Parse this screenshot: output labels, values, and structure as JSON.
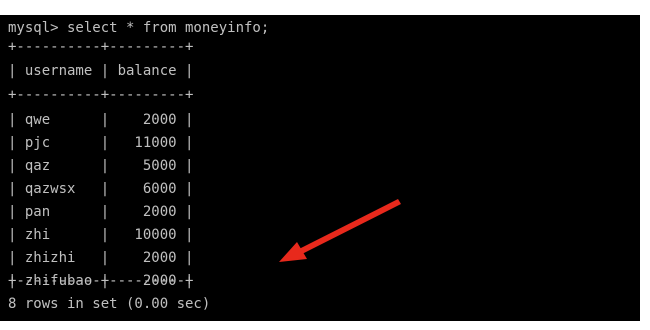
{
  "terminal": {
    "prompt_line": "mysql> select * from moneyinfo;",
    "border_line": "+----------+---------+",
    "header_line": "| username | balance |",
    "rows": [
      "| qwe      |    2000 |",
      "| pjc      |   11000 |",
      "| qaz      |    5000 |",
      "| qazwsx   |    6000 |",
      "| pan      |    2000 |",
      "| zhi      |   10000 |",
      "| zhizhi   |    2000 |",
      "| zhifubao |    2000 |"
    ],
    "footer_line": "8 rows in set (0.00 sec)"
  },
  "table": {
    "columns": [
      "username",
      "balance"
    ],
    "data": [
      [
        "qwe",
        "2000"
      ],
      [
        "pjc",
        "11000"
      ],
      [
        "qaz",
        "5000"
      ],
      [
        "qazwsx",
        "6000"
      ],
      [
        "pan",
        "2000"
      ],
      [
        "zhi",
        "10000"
      ],
      [
        "zhizhi",
        "2000"
      ],
      [
        "zhifubao",
        "2000"
      ]
    ]
  },
  "colors": {
    "terminal_bg": "#000000",
    "terminal_text": "#c0c0c0",
    "annotation_arrow": "#e8291c"
  },
  "annotation": {
    "icon": "red-arrow-icon",
    "points_to_row": "zhifubao"
  }
}
